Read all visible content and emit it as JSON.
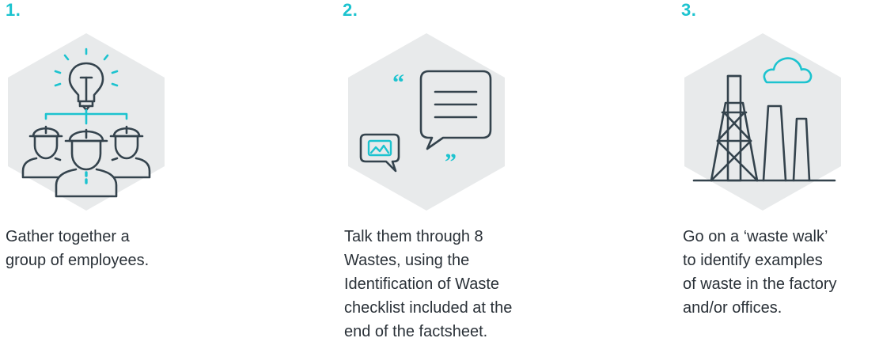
{
  "colors": {
    "accent": "#1cc3cf",
    "icon_stroke": "#34434d",
    "hexagon_fill": "#e8eaeb",
    "text": "#2a3138"
  },
  "steps": [
    {
      "number": "1.",
      "icon": "team-idea-icon",
      "text": "Gather together a\ngroup of employees."
    },
    {
      "number": "2.",
      "icon": "discussion-icon",
      "text": "Talk them through 8\nWastes, using the\nIdentification of Waste\nchecklist included at the\nend of the factsheet."
    },
    {
      "number": "3.",
      "icon": "factory-icon",
      "text": "Go on a ‘waste walk’\nto identify examples\nof waste in the factory\nand/or offices."
    }
  ]
}
